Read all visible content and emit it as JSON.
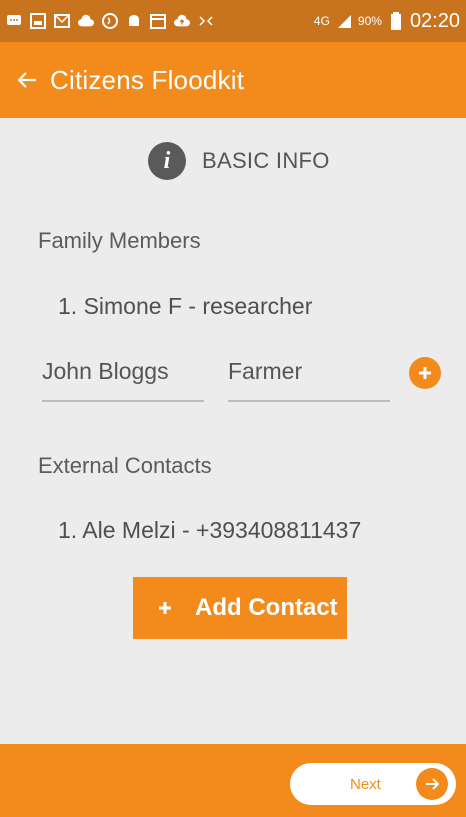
{
  "status_bar": {
    "network": "4G",
    "battery": "90%",
    "time": "02:20"
  },
  "app_bar": {
    "title": "Citizens Floodkit",
    "back_icon": "arrow-left-icon"
  },
  "section": {
    "title": "BASIC INFO",
    "icon": "info-icon"
  },
  "family": {
    "label": "Family Members",
    "items": [
      "1. Simone F - researcher"
    ],
    "name_input_value": "John Bloggs",
    "role_input_value": "Farmer"
  },
  "contacts": {
    "label": "External Contacts",
    "items": [
      "1. Ale Melzi - +393408811437"
    ],
    "add_button_label": "Add Contact"
  },
  "footer": {
    "next_label": "Next"
  },
  "colors": {
    "accent": "#f28b1c",
    "status_bar": "#c8731e",
    "background": "#ececec"
  }
}
